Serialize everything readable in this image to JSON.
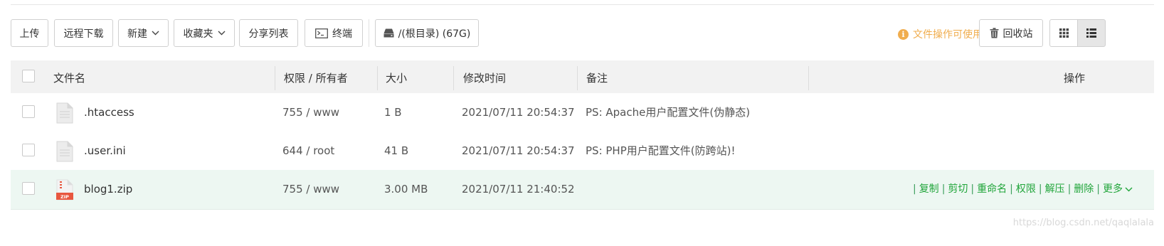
{
  "toolbar": {
    "upload": "上传",
    "remote_download": "远程下载",
    "new": "新建",
    "favorites": "收藏夹",
    "share_list": "分享列表",
    "terminal": "终端",
    "path": "/(根目录) (67G)",
    "hint": "文件操作可使用右键",
    "recycle_bin": "回收站"
  },
  "table": {
    "columns": {
      "name": "文件名",
      "perm": "权限 / 所有者",
      "size": "大小",
      "mtime": "修改时间",
      "note": "备注",
      "ops": "操作"
    },
    "rows": [
      {
        "name": ".htaccess",
        "perm": "755 / www",
        "size": "1 B",
        "mtime": "2021/07/11 20:54:37",
        "note": "PS: Apache用户配置文件(伪静态)",
        "icon": "file-icon"
      },
      {
        "name": ".user.ini",
        "perm": "644 / root",
        "size": "41 B",
        "mtime": "2021/07/11 20:54:37",
        "note": "PS: PHP用户配置文件(防跨站)!",
        "icon": "file-icon"
      },
      {
        "name": "blog1.zip",
        "perm": "755 / www",
        "size": "3.00 MB",
        "mtime": "2021/07/11 21:40:52",
        "note": "",
        "icon": "zip-file-icon"
      }
    ],
    "row_actions": {
      "copy": "复制",
      "cut": "剪切",
      "rename": "重命名",
      "perm": "权限",
      "extract": "解压",
      "delete": "删除",
      "more": "更多"
    }
  },
  "zip_icon_label": "ZIP",
  "watermark": "https://blog.csdn.net/qaqlalala",
  "colors": {
    "accent_green": "#20a53a",
    "hint_orange": "#f0ad4e",
    "active_row": "#edf7f2"
  }
}
